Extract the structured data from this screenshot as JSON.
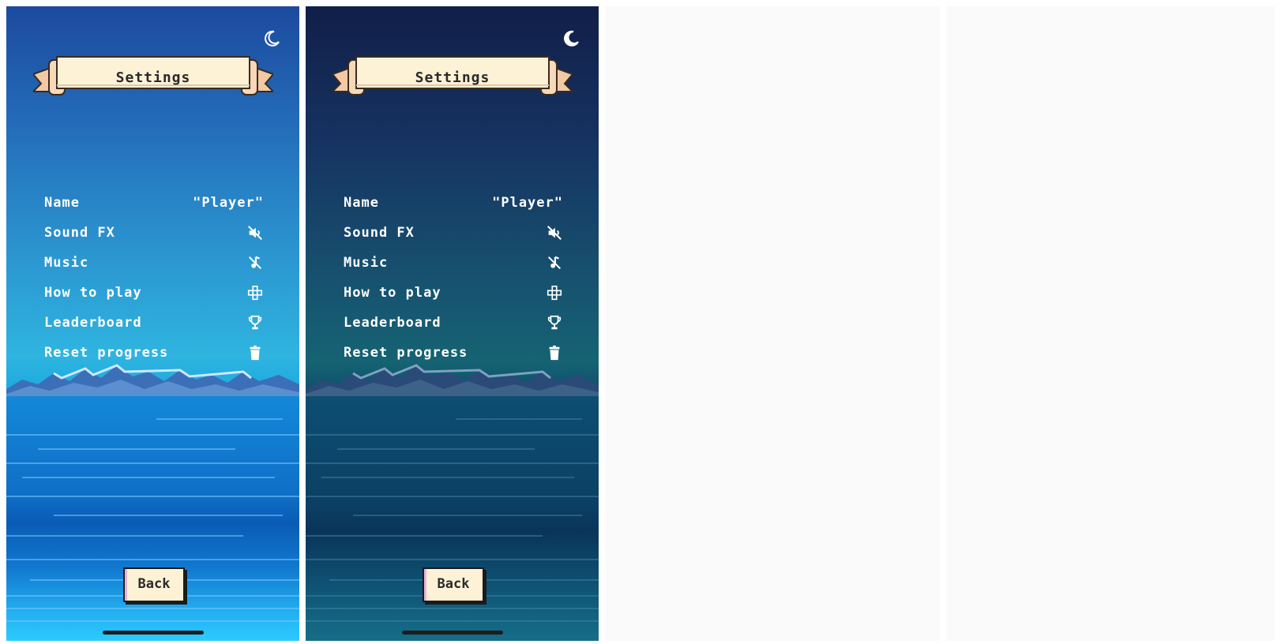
{
  "screens": [
    {
      "theme": "light",
      "theme_icon": "moon-outline-icon",
      "title": "Settings",
      "items": [
        {
          "label": "Name",
          "value": "\"Player\""
        },
        {
          "label": "Sound FX",
          "icon": "sound-off-icon"
        },
        {
          "label": "Music",
          "icon": "music-off-icon"
        },
        {
          "label": "How to play",
          "icon": "gamepad-icon"
        },
        {
          "label": "Leaderboard",
          "icon": "trophy-icon"
        },
        {
          "label": "Reset progress",
          "icon": "trash-icon"
        }
      ],
      "back_label": "Back"
    },
    {
      "theme": "dark",
      "theme_icon": "moon-filled-icon",
      "title": "Settings",
      "items": [
        {
          "label": "Name",
          "value": "\"Player\""
        },
        {
          "label": "Sound FX",
          "icon": "sound-off-icon"
        },
        {
          "label": "Music",
          "icon": "music-off-icon"
        },
        {
          "label": "How to play",
          "icon": "gamepad-icon"
        },
        {
          "label": "Leaderboard",
          "icon": "trophy-icon"
        },
        {
          "label": "Reset progress",
          "icon": "trash-icon"
        }
      ],
      "back_label": "Back"
    }
  ],
  "colors": {
    "banner_fill": "#fdf1d6",
    "text_light": "#ffffff",
    "text_dark": "#2a2a2a"
  }
}
